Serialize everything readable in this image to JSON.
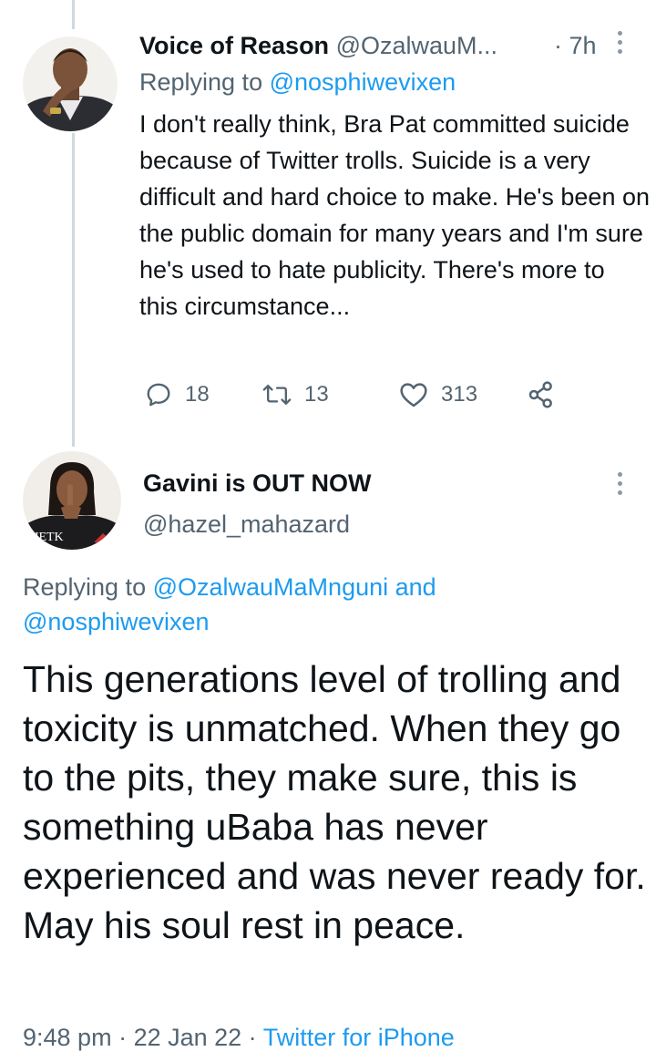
{
  "tweet1": {
    "display_name": "Voice of Reason",
    "handle": "@OzalwauM...",
    "time": "· 7h",
    "replying_label": "Replying to ",
    "replying_to": "@nosphiwevixen",
    "text": "I don't really think, Bra Pat committed suicide because of Twitter trolls. Suicide is a very difficult and hard choice to make. He's been on the public domain for many years and I'm sure he's used to hate publicity. There's more to this circumstance...",
    "replies": "18",
    "retweets": "13",
    "likes": "313",
    "icons": [
      "reply-icon",
      "retweet-icon",
      "like-icon",
      "share-icon",
      "more-icon"
    ]
  },
  "tweet2": {
    "display_name": "Gavini is OUT NOW",
    "handle": "@hazel_mahazard",
    "replying_label": "Replying to ",
    "replying_to_1": "@OzalwauMaMnguni",
    "replying_and": " and",
    "replying_to_2": "@nosphiwevixen",
    "text": "This generations level of trolling and toxicity is unmatched. When they go to the pits, they make sure, this is something uBaba has never experienced and was never ready for. May his soul rest in peace.",
    "time": "9:48 pm",
    "sep1": " · ",
    "date": "22 Jan 22",
    "sep2": " · ",
    "source": "Twitter for iPhone"
  },
  "colors": {
    "text": "#0f1419",
    "secondary": "#536471",
    "link": "#1d9bf0",
    "thread_line": "#cfd9de"
  }
}
